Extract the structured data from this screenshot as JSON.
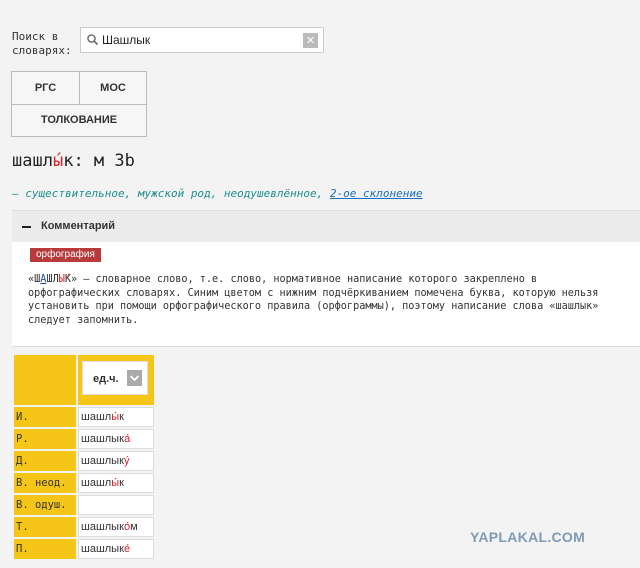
{
  "search": {
    "label_line1": "Поиск в",
    "label_line2": "словарях:",
    "value": "Шашлык",
    "placeholder": "",
    "clear_symbol": "✕"
  },
  "tabs": [
    {
      "label": "РГС"
    },
    {
      "label": "МОС"
    },
    {
      "label": "ТОЛКОВАНИЕ"
    }
  ],
  "headword": {
    "pre_stress": "шашл",
    "stressed": "ы́",
    "post_stress": "к",
    "grammar_tag": ": м 3b"
  },
  "grammar_line": {
    "dash": "—",
    "description": "существительное, мужской род, неодушевлённое,",
    "declension_link": "2-ое склонение"
  },
  "comment": {
    "title": "Комментарий",
    "badge": "орфография",
    "open_quote": "«",
    "word_marked": [
      "Ш",
      "А",
      "Ш",
      "Л",
      "Ы",
      "́",
      "К"
    ],
    "text": "» — словарное слово, т.е. слово, нормативное написание которого закреплено в орфографических словарях. Синим цветом с нижним подчёркиванием помечена буква, которую нельзя установить при помощи орфографического правила (орфограммы), поэтому написание слова «шашлык» следует запомнить."
  },
  "paradigm": {
    "number_header": "ед.ч.",
    "rows": [
      {
        "case": "И.",
        "form_base": "шашл",
        "form_stress": "ы́",
        "form_end": "к"
      },
      {
        "case": "Р.",
        "form_base": "шашлык",
        "form_stress": "а́",
        "form_end": ""
      },
      {
        "case": "Д.",
        "form_base": "шашлык",
        "form_stress": "у́",
        "form_end": ""
      },
      {
        "case": "В. неод.",
        "form_base": "шашл",
        "form_stress": "ы́",
        "form_end": "к"
      },
      {
        "case": "В. одуш.",
        "form_base": "",
        "form_stress": "",
        "form_end": ""
      },
      {
        "case": "Т.",
        "form_base": "шашлык",
        "form_stress": "о́",
        "form_end": "м"
      },
      {
        "case": "П.",
        "form_base": "шашлык",
        "form_stress": "е́",
        "form_end": ""
      }
    ]
  },
  "watermark": "YAPLAKAL.COM",
  "colors": {
    "accent_yellow": "#f5c518",
    "stress_red": "#e0202a",
    "badge_red": "#b73b3b",
    "grammar_teal": "#1f8f8f",
    "link_blue": "#1a6fc0",
    "marked_blue": "#1a4fb0"
  }
}
